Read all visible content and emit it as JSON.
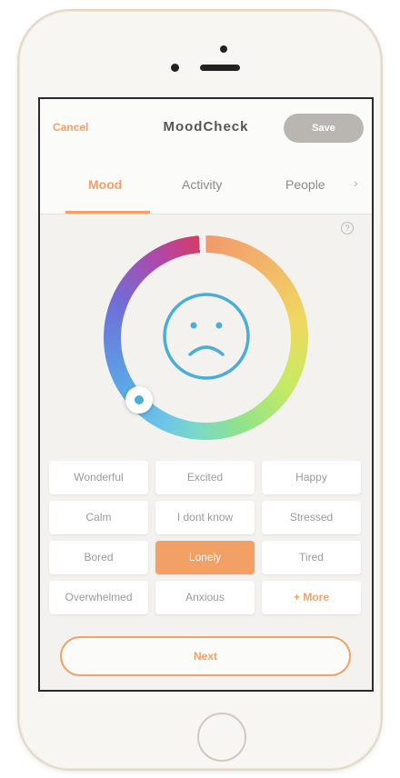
{
  "header": {
    "cancel_label": "Cancel",
    "title": "MoodCheck",
    "save_label": "Save"
  },
  "tabs": [
    {
      "label": "Mood",
      "active": true
    },
    {
      "label": "Activity",
      "active": false
    },
    {
      "label": "People",
      "active": false
    }
  ],
  "tab_next_icon": "chevron-right-icon",
  "help_icon": "?",
  "mood_wheel": {
    "face": "sad-face-icon",
    "accent_color": "#4aaed8"
  },
  "moods": [
    {
      "label": "Wonderful",
      "selected": false
    },
    {
      "label": "Excited",
      "selected": false
    },
    {
      "label": "Happy",
      "selected": false
    },
    {
      "label": "Calm",
      "selected": false
    },
    {
      "label": "I dont know",
      "selected": false
    },
    {
      "label": "Stressed",
      "selected": false
    },
    {
      "label": "Bored",
      "selected": false
    },
    {
      "label": "Lonely",
      "selected": true
    },
    {
      "label": "Tired",
      "selected": false
    },
    {
      "label": "Overwhelmed",
      "selected": false
    },
    {
      "label": "Anxious",
      "selected": false
    },
    {
      "label": "+ More",
      "selected": false
    }
  ],
  "next_label": "Next",
  "colors": {
    "accent": "#f2a066",
    "save_disabled": "#b9b6b2"
  }
}
